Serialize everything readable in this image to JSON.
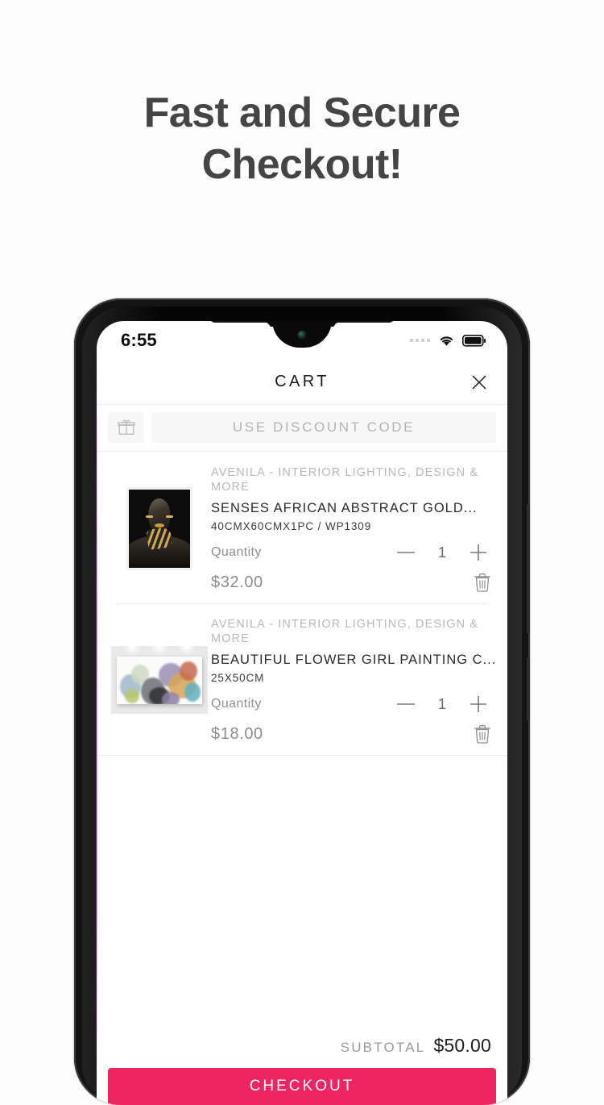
{
  "promo": {
    "line1": "Fast and Secure",
    "line2": "Checkout!"
  },
  "statusbar": {
    "time": "6:55",
    "signal_icon": "signal-dots-icon",
    "wifi_icon": "wifi-icon",
    "battery_icon": "battery-full-icon"
  },
  "header": {
    "title": "CART",
    "close_icon": "close-icon"
  },
  "discount": {
    "gift_icon": "gift-icon",
    "placeholder": "USE DISCOUNT CODE"
  },
  "cart": {
    "items": [
      {
        "brand": "AVENILA - INTERIOR LIGHTING, DESIGN & MORE",
        "name": "SENSES AFRICAN ABSTRACT GOLD...",
        "variant": "40CMX60CMX1PC / WP1309",
        "quantity_label": "Quantity",
        "quantity": "1",
        "minus_icon": "minus-icon",
        "plus_icon": "plus-icon",
        "price": "$32.00",
        "delete_icon": "trash-icon",
        "thumbnail_alt": "african-abstract-gold-artwork"
      },
      {
        "brand": "AVENILA - INTERIOR LIGHTING, DESIGN & MORE",
        "name": "BEAUTIFUL FLOWER GIRL PAINTING C...",
        "variant": "25X50CM",
        "quantity_label": "Quantity",
        "quantity": "1",
        "minus_icon": "minus-icon",
        "plus_icon": "plus-icon",
        "price": "$18.00",
        "delete_icon": "trash-icon",
        "thumbnail_alt": "flower-girl-painting-canvas"
      }
    ]
  },
  "footer": {
    "subtotal_label": "SUBTOTAL",
    "subtotal_value": "$50.00",
    "checkout_label": "CHECKOUT"
  },
  "colors": {
    "accent_pink": "#ee2560",
    "heading_gray": "#454545",
    "muted_text": "#b8b8b8"
  }
}
